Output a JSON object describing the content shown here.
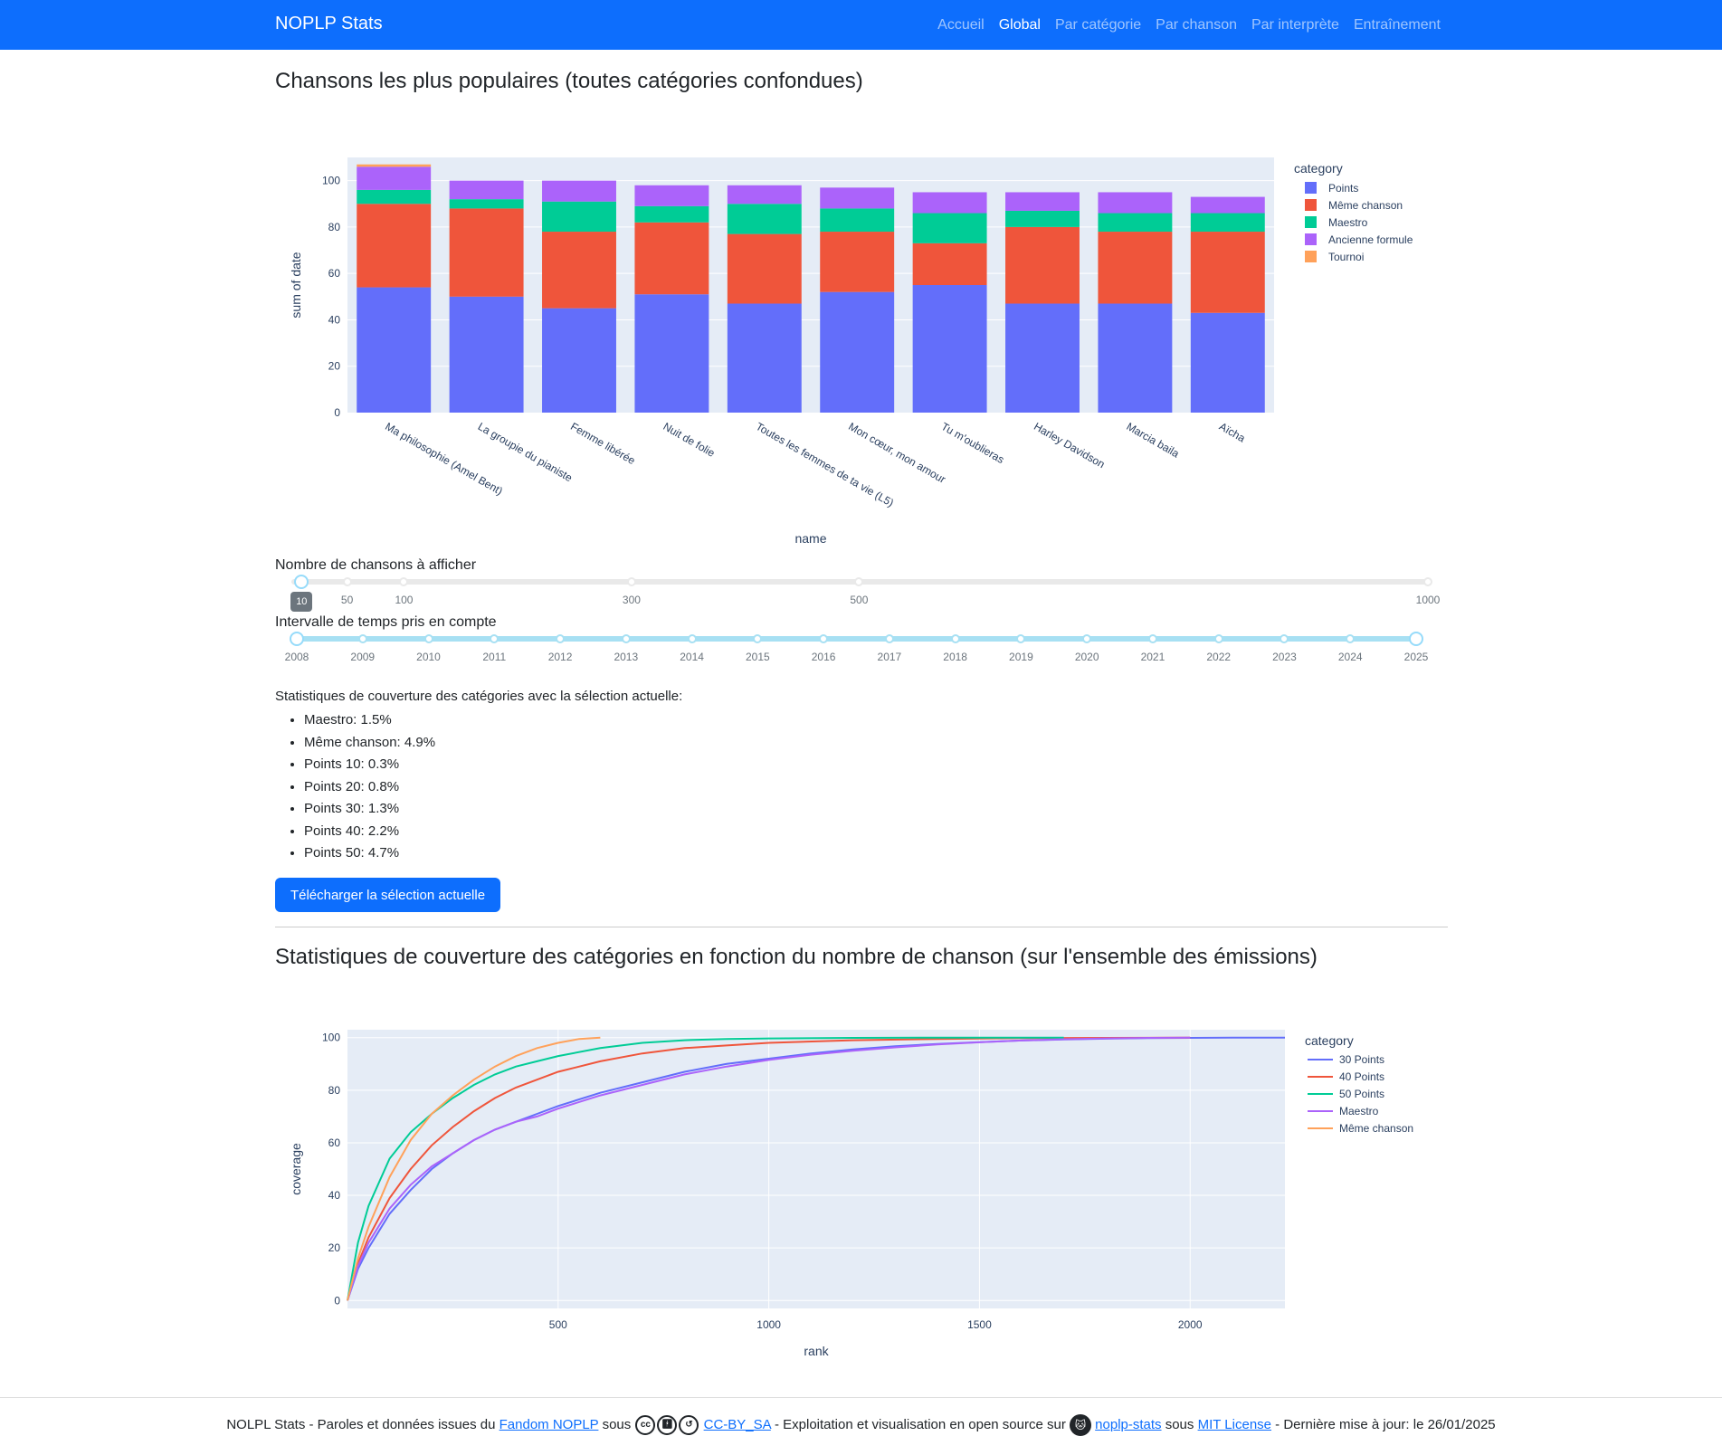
{
  "navbar": {
    "brand": "NOPLP Stats",
    "links": [
      {
        "label": "Accueil",
        "active": false
      },
      {
        "label": "Global",
        "active": true
      },
      {
        "label": "Par catégorie",
        "active": false
      },
      {
        "label": "Par chanson",
        "active": false
      },
      {
        "label": "Par interprète",
        "active": false
      },
      {
        "label": "Entraînement",
        "active": false
      }
    ]
  },
  "popular": {
    "title": "Chansons les plus populaires (toutes catégories confondues)"
  },
  "sliders": {
    "count_label": "Nombre de chansons à afficher",
    "count_value": "10",
    "count_marks": [
      "50",
      "100",
      "300",
      "500",
      "1000"
    ],
    "count_min": 1,
    "count_max": 1000,
    "years_label": "Intervalle de temps pris en compte",
    "years": [
      "2008",
      "2009",
      "2010",
      "2011",
      "2012",
      "2013",
      "2014",
      "2015",
      "2016",
      "2017",
      "2018",
      "2019",
      "2020",
      "2021",
      "2022",
      "2023",
      "2024",
      "2025"
    ]
  },
  "stats": {
    "heading": "Statistiques de couverture des catégories avec la sélection actuelle:",
    "items": [
      "Maestro: 1.5%",
      "Même chanson: 4.9%",
      "Points 10: 0.3%",
      "Points 20: 0.8%",
      "Points 30: 1.3%",
      "Points 40: 2.2%",
      "Points 50: 4.7%"
    ]
  },
  "download_button": "Télécharger la sélection actuelle",
  "coverage": {
    "title": "Statistiques de couverture des catégories en fonction du nombre de chanson (sur l'ensemble des émissions)"
  },
  "footer": {
    "t1": "NOLPL Stats - Paroles et données issues du ",
    "link1": "Fandom NOPLP",
    "t2": " sous ",
    "link2": "CC-BY_SA",
    "t3": " - Exploitation et visualisation en open source sur ",
    "link3": "noplp-stats",
    "t4": " sous ",
    "link4": "MIT License",
    "t5": " - Dernière mise à jour: le 26/01/2025"
  },
  "chart_data": [
    {
      "type": "bar",
      "stacked": true,
      "xlabel": "name",
      "ylabel": "sum of date",
      "ylim": [
        0,
        110
      ],
      "yticks": [
        0,
        20,
        40,
        60,
        80,
        100
      ],
      "grid": true,
      "legend_title": "category",
      "legend_position": "right",
      "categories": [
        "Ma philosophie (Amel Bent)",
        "La groupie du pianiste",
        "Femme libérée",
        "Nuit de folie",
        "Toutes les femmes de ta vie (L5)",
        "Mon cœur, mon amour",
        "Tu m'oublieras",
        "Harley Davidson",
        "Marcia baila",
        "Aïcha"
      ],
      "series": [
        {
          "name": "Points",
          "color": "#636efa",
          "values": [
            54,
            50,
            45,
            51,
            47,
            52,
            55,
            47,
            47,
            43
          ]
        },
        {
          "name": "Même chanson",
          "color": "#ef553b",
          "values": [
            36,
            38,
            33,
            31,
            30,
            26,
            18,
            33,
            31,
            35
          ]
        },
        {
          "name": "Maestro",
          "color": "#00cc96",
          "values": [
            6,
            4,
            13,
            7,
            13,
            10,
            13,
            7,
            8,
            8
          ]
        },
        {
          "name": "Ancienne formule",
          "color": "#ab63fa",
          "values": [
            10,
            8,
            9,
            9,
            8,
            9,
            9,
            8,
            9,
            7
          ]
        },
        {
          "name": "Tournoi",
          "color": "#ffa15a",
          "values": [
            1,
            0,
            0,
            0,
            0,
            0,
            0,
            0,
            0,
            0
          ]
        }
      ]
    },
    {
      "type": "line",
      "xlabel": "rank",
      "ylabel": "coverage",
      "xlim": [
        0,
        2225
      ],
      "ylim": [
        -3,
        103
      ],
      "xticks": [
        500,
        1000,
        1500,
        2000
      ],
      "yticks": [
        0,
        20,
        40,
        60,
        80,
        100
      ],
      "grid": true,
      "legend_title": "category",
      "legend_position": "right",
      "series": [
        {
          "name": "30 Points",
          "color": "#636efa",
          "x": [
            0,
            25,
            50,
            100,
            150,
            200,
            250,
            300,
            350,
            400,
            450,
            500,
            600,
            700,
            800,
            900,
            1000,
            1100,
            1200,
            1300,
            1400,
            1500,
            1600,
            1700,
            1800,
            1900,
            2000,
            2100,
            2225
          ],
          "y": [
            0,
            12,
            20,
            33,
            42,
            50,
            56,
            61,
            65,
            68,
            71,
            74,
            79,
            83,
            87,
            90,
            92,
            94,
            95.5,
            96.7,
            97.6,
            98.3,
            98.9,
            99.3,
            99.6,
            99.8,
            99.9,
            100,
            100
          ]
        },
        {
          "name": "40 Points",
          "color": "#ef553b",
          "x": [
            0,
            25,
            50,
            100,
            150,
            200,
            250,
            300,
            350,
            400,
            450,
            500,
            600,
            700,
            800,
            900,
            1000,
            1200,
            1400,
            1600,
            1800,
            2000
          ],
          "y": [
            0,
            14,
            24,
            39,
            50,
            59,
            66,
            72,
            77,
            81,
            84,
            87,
            91,
            94,
            96,
            97,
            98,
            99,
            99.5,
            99.8,
            99.9,
            100
          ]
        },
        {
          "name": "50 Points",
          "color": "#00cc96",
          "x": [
            0,
            25,
            50,
            100,
            150,
            200,
            250,
            300,
            350,
            400,
            450,
            500,
            600,
            700,
            800,
            900,
            1000,
            1200,
            1400,
            1700
          ],
          "y": [
            0,
            22,
            36,
            54,
            64,
            71,
            77,
            82,
            86,
            89,
            91,
            93,
            96,
            98,
            99,
            99.5,
            99.7,
            99.9,
            100,
            100
          ]
        },
        {
          "name": "Maestro",
          "color": "#ab63fa",
          "x": [
            0,
            25,
            50,
            100,
            150,
            200,
            250,
            300,
            350,
            400,
            450,
            500,
            600,
            700,
            800,
            900,
            1000,
            1100,
            1200,
            1300,
            1400,
            1500,
            1600,
            1700,
            1800,
            1900,
            2000
          ],
          "y": [
            0,
            13,
            22,
            35,
            44,
            51,
            56,
            61,
            65,
            68,
            70,
            73,
            78,
            82,
            86,
            89,
            91.5,
            93.5,
            95,
            96.3,
            97.4,
            98.2,
            98.9,
            99.4,
            99.7,
            99.9,
            100
          ]
        },
        {
          "name": "Même chanson",
          "color": "#ffa15a",
          "x": [
            0,
            25,
            50,
            100,
            150,
            200,
            250,
            300,
            350,
            400,
            450,
            500,
            550,
            600
          ],
          "y": [
            0,
            16,
            28,
            47,
            61,
            71,
            78,
            84,
            89,
            93,
            96,
            98,
            99.5,
            100
          ]
        }
      ]
    }
  ]
}
